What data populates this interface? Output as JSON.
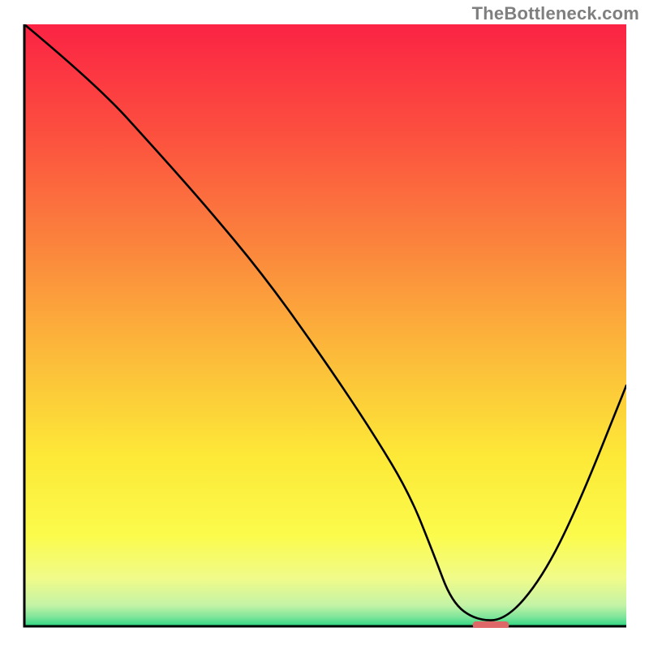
{
  "watermark": "TheBottleneck.com",
  "chart_data": {
    "type": "line",
    "title": "",
    "xlabel": "",
    "ylabel": "",
    "xlim": [
      0,
      100
    ],
    "ylim": [
      0,
      100
    ],
    "x": [
      0,
      12,
      22,
      30,
      40,
      50,
      58,
      64,
      68,
      71,
      75,
      80,
      86,
      92,
      100
    ],
    "values": [
      100,
      90,
      79,
      70,
      58,
      44,
      32,
      22,
      12,
      4,
      1,
      1,
      8,
      20,
      40
    ],
    "min_marker": {
      "x_center": 77.5,
      "width": 6,
      "color": "#e06767"
    },
    "gradient_stops": [
      {
        "offset": 0.0,
        "color": "#fb2344"
      },
      {
        "offset": 0.18,
        "color": "#fc4f3f"
      },
      {
        "offset": 0.36,
        "color": "#fb823d"
      },
      {
        "offset": 0.55,
        "color": "#fcbb3a"
      },
      {
        "offset": 0.72,
        "color": "#fde937"
      },
      {
        "offset": 0.85,
        "color": "#fbfb4c"
      },
      {
        "offset": 0.92,
        "color": "#f1fb89"
      },
      {
        "offset": 0.965,
        "color": "#c4f3a6"
      },
      {
        "offset": 0.985,
        "color": "#7de59a"
      },
      {
        "offset": 1.0,
        "color": "#2bd681"
      }
    ],
    "axis_color": "#000000",
    "line_color": "#000000"
  }
}
